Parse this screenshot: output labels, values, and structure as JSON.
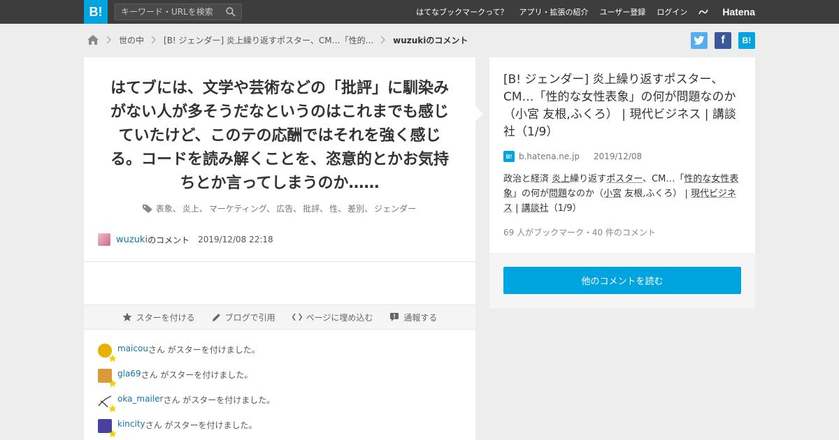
{
  "header": {
    "logo": "B!",
    "search_placeholder": "キーワード・URLを検索",
    "nav": [
      "はてなブックマークって？",
      "アプリ・拡張の紹介",
      "ユーザー登録",
      "ログイン"
    ],
    "brand": "Hatena"
  },
  "breadcrumb": {
    "items": [
      "世の中",
      "[B! ジェンダー] 炎上繰り返すポスター、CM…「性的..."
    ],
    "current": "wuzukiのコメント"
  },
  "social": {
    "facebook": "f",
    "hatena": "B!"
  },
  "comment": {
    "text": "はてブには、文学や芸術などの「批評」に馴染みがない人が多そうだなというのはこれまでも感じていたけど、このテの応酬ではそれを強く感じる。コードを読み解くことを、恣意的とかお気持ちとか言ってしまうのか……",
    "tags": [
      "表象、",
      "炎上、",
      "マーケティング、",
      "広告、",
      "批評、",
      "性、",
      "差別、",
      "ジェンダー"
    ],
    "user": "wuzuki",
    "user_suffix": "のコメント",
    "date": "2019/12/08 22:18"
  },
  "actions": [
    "スターを付ける",
    "ブログで引用",
    "ページに埋め込む",
    "通報する"
  ],
  "stars": {
    "suffix": "さん がスターを付けました。",
    "users": [
      {
        "name": "maicou",
        "color": "#e8b000"
      },
      {
        "name": "gla69",
        "color": "#d89a3a"
      },
      {
        "name": "oka_mailer",
        "color": "#ffffff"
      },
      {
        "name": "kincity",
        "color": "#4b3fa0"
      }
    ]
  },
  "entry": {
    "title": "[B! ジェンダー] 炎上繰り返すポスター、CM…「性的な女性表象」の何が問題なのか（小宮 友根,ふくろ） | 現代ビジネス | 講談社（1/9）",
    "domain": "b.hatena.ne.jp",
    "date": "2019/12/08",
    "desc_parts": [
      {
        "t": "政治と経済",
        "kw": false
      },
      {
        "t": " ",
        "kw": false
      },
      {
        "t": "炎上",
        "kw": true
      },
      {
        "t": "繰り返す",
        "kw": false
      },
      {
        "t": "ポスター",
        "kw": true
      },
      {
        "t": "、CM…「",
        "kw": false
      },
      {
        "t": "性的な女性表象",
        "kw": true
      },
      {
        "t": "」の何が",
        "kw": false
      },
      {
        "t": "問題",
        "kw": true
      },
      {
        "t": "なのか（",
        "kw": false
      },
      {
        "t": "小宮",
        "kw": true
      },
      {
        "t": " 友根,ふくろ） | ",
        "kw": false
      },
      {
        "t": "現代ビジネス",
        "kw": true
      },
      {
        "t": " | ",
        "kw": false
      },
      {
        "t": "講談社",
        "kw": true
      },
      {
        "t": "（1/9）",
        "kw": false
      }
    ],
    "count": "69 人がブックマーク・40 件のコメント",
    "more_button": "他のコメントを読む"
  }
}
